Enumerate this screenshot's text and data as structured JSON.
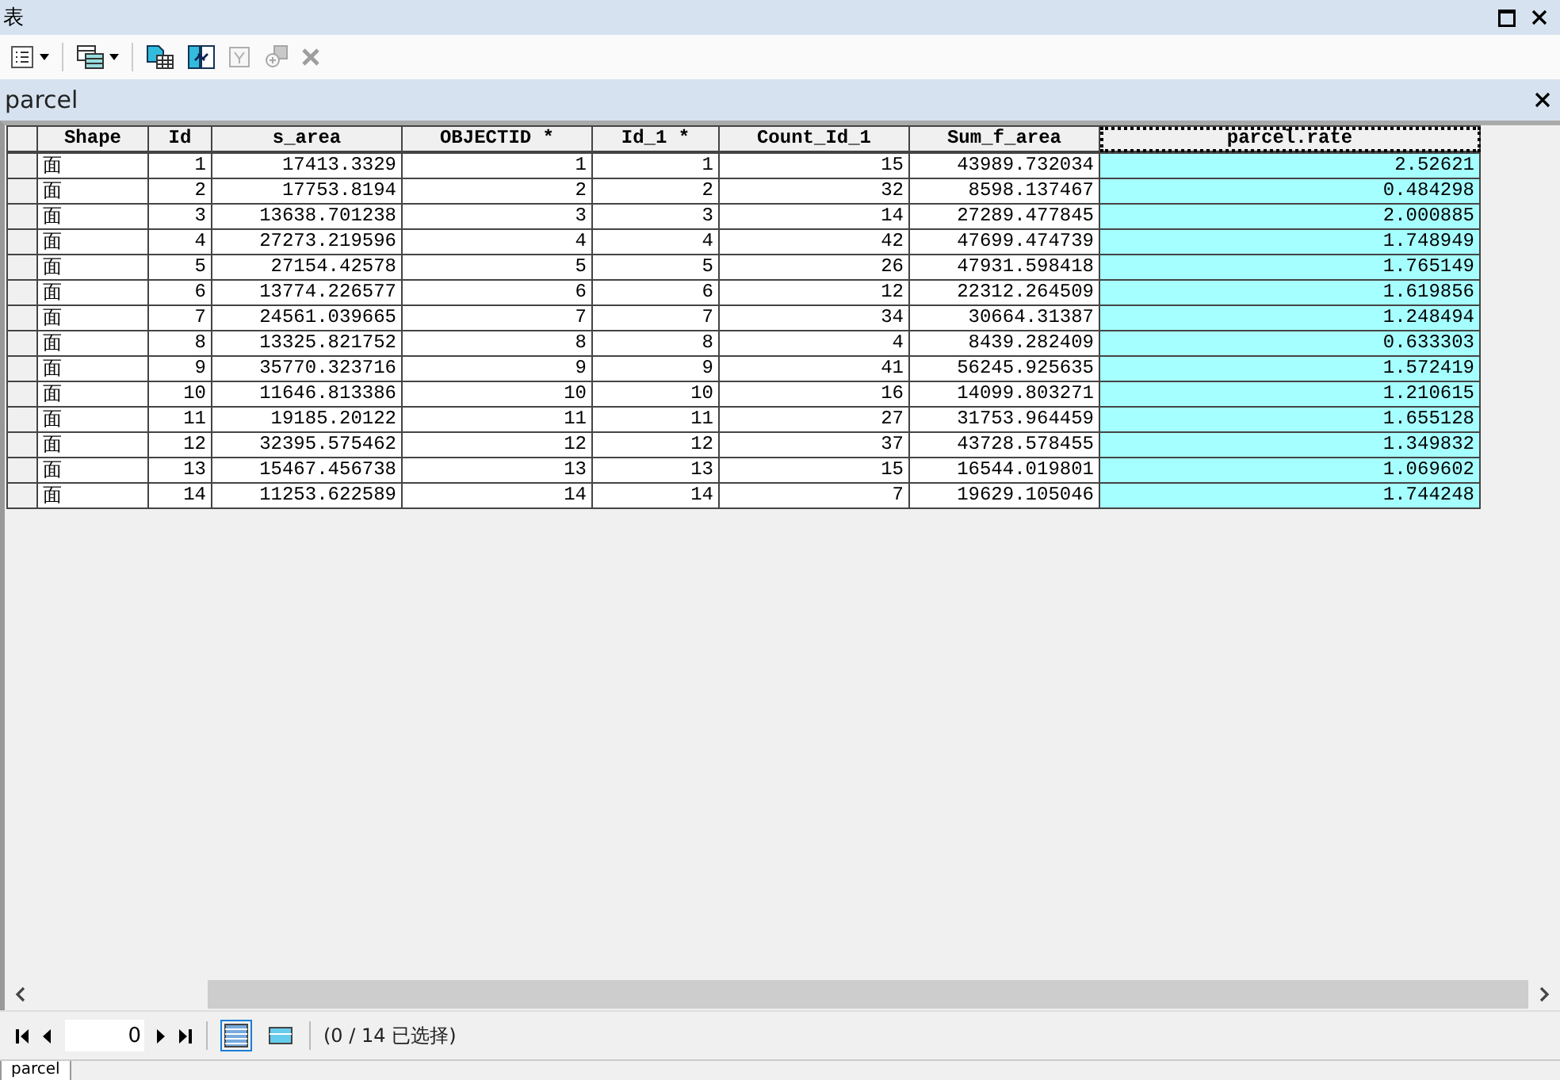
{
  "window": {
    "title": "表"
  },
  "toolbar": [
    {
      "kind": "options",
      "dropdown": true,
      "disabled": false
    },
    {
      "kind": "relate",
      "dropdown": true,
      "disabled": false
    },
    {
      "kind": "select-by-attr",
      "dropdown": false,
      "disabled": false
    },
    {
      "kind": "switch-selection",
      "dropdown": false,
      "disabled": false
    },
    {
      "kind": "clear-selection",
      "dropdown": false,
      "disabled": true
    },
    {
      "kind": "zoom-selected",
      "dropdown": false,
      "disabled": true
    },
    {
      "kind": "delete",
      "dropdown": false,
      "disabled": true
    }
  ],
  "table_tab": {
    "title": "parcel"
  },
  "table": {
    "columns": [
      {
        "label": "Shape",
        "kind": "text",
        "selected": false
      },
      {
        "label": "Id",
        "kind": "number",
        "selected": false
      },
      {
        "label": "s_area",
        "kind": "number",
        "selected": false
      },
      {
        "label": "OBJECTID *",
        "kind": "number",
        "selected": false
      },
      {
        "label": "Id_1 *",
        "kind": "number",
        "selected": false
      },
      {
        "label": "Count_Id_1",
        "kind": "number",
        "selected": false
      },
      {
        "label": "Sum_f_area",
        "kind": "number",
        "selected": false
      },
      {
        "label": "parcel.rate",
        "kind": "number",
        "selected": true
      }
    ],
    "rows": [
      [
        "面",
        "1",
        "17413.3329",
        "1",
        "1",
        "15",
        "43989.732034",
        "2.52621"
      ],
      [
        "面",
        "2",
        "17753.8194",
        "2",
        "2",
        "32",
        "8598.137467",
        "0.484298"
      ],
      [
        "面",
        "3",
        "13638.701238",
        "3",
        "3",
        "14",
        "27289.477845",
        "2.000885"
      ],
      [
        "面",
        "4",
        "27273.219596",
        "4",
        "4",
        "42",
        "47699.474739",
        "1.748949"
      ],
      [
        "面",
        "5",
        "27154.42578",
        "5",
        "5",
        "26",
        "47931.598418",
        "1.765149"
      ],
      [
        "面",
        "6",
        "13774.226577",
        "6",
        "6",
        "12",
        "22312.264509",
        "1.619856"
      ],
      [
        "面",
        "7",
        "24561.039665",
        "7",
        "7",
        "34",
        "30664.31387",
        "1.248494"
      ],
      [
        "面",
        "8",
        "13325.821752",
        "8",
        "8",
        "4",
        "8439.282409",
        "0.633303"
      ],
      [
        "面",
        "9",
        "35770.323716",
        "9",
        "9",
        "41",
        "56245.925635",
        "1.572419"
      ],
      [
        "面",
        "10",
        "11646.813386",
        "10",
        "10",
        "16",
        "14099.803271",
        "1.210615"
      ],
      [
        "面",
        "11",
        "19185.20122",
        "11",
        "11",
        "27",
        "31753.964459",
        "1.655128"
      ],
      [
        "面",
        "12",
        "32395.575462",
        "12",
        "12",
        "37",
        "43728.578455",
        "1.349832"
      ],
      [
        "面",
        "13",
        "15467.456738",
        "13",
        "13",
        "15",
        "16544.019801",
        "1.069602"
      ],
      [
        "面",
        "14",
        "11253.622589",
        "14",
        "14",
        "7",
        "19629.105046",
        "1.744248"
      ]
    ]
  },
  "navigator": {
    "record": "0",
    "views": [
      {
        "kind": "all",
        "selected": true
      },
      {
        "kind": "selected",
        "selected": false
      }
    ],
    "status": "(0 / 14 已选择)"
  },
  "bottom_tabs": [
    {
      "label": "parcel",
      "selected": true
    }
  ]
}
